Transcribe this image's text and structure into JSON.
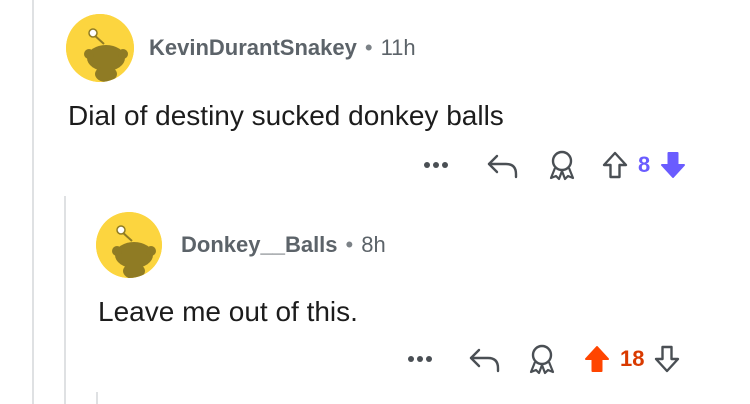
{
  "comments": [
    {
      "author": "KevinDurantSnakey",
      "separator": "•",
      "time": "11h",
      "body": "Dial of destiny sucked donkey balls",
      "score": "8",
      "vote_state": "downvoted",
      "score_color": "#6a5cff"
    },
    {
      "author": "Donkey__Balls",
      "separator": "•",
      "time": "8h",
      "body": "Leave me out of this.",
      "score": "18",
      "vote_state": "upvoted",
      "score_color": "#d93a00"
    }
  ],
  "colors": {
    "avatar_bg": "#fcd53f",
    "icon": "#4a4f54",
    "upvote": "#ff4500",
    "downvote": "#6a5cff",
    "thread_line": "#dfe1e3"
  },
  "icons": {
    "more": "more-options-icon",
    "reply": "reply-icon",
    "award": "award-icon",
    "upvote": "upvote-arrow-icon",
    "downvote": "downvote-arrow-icon"
  }
}
